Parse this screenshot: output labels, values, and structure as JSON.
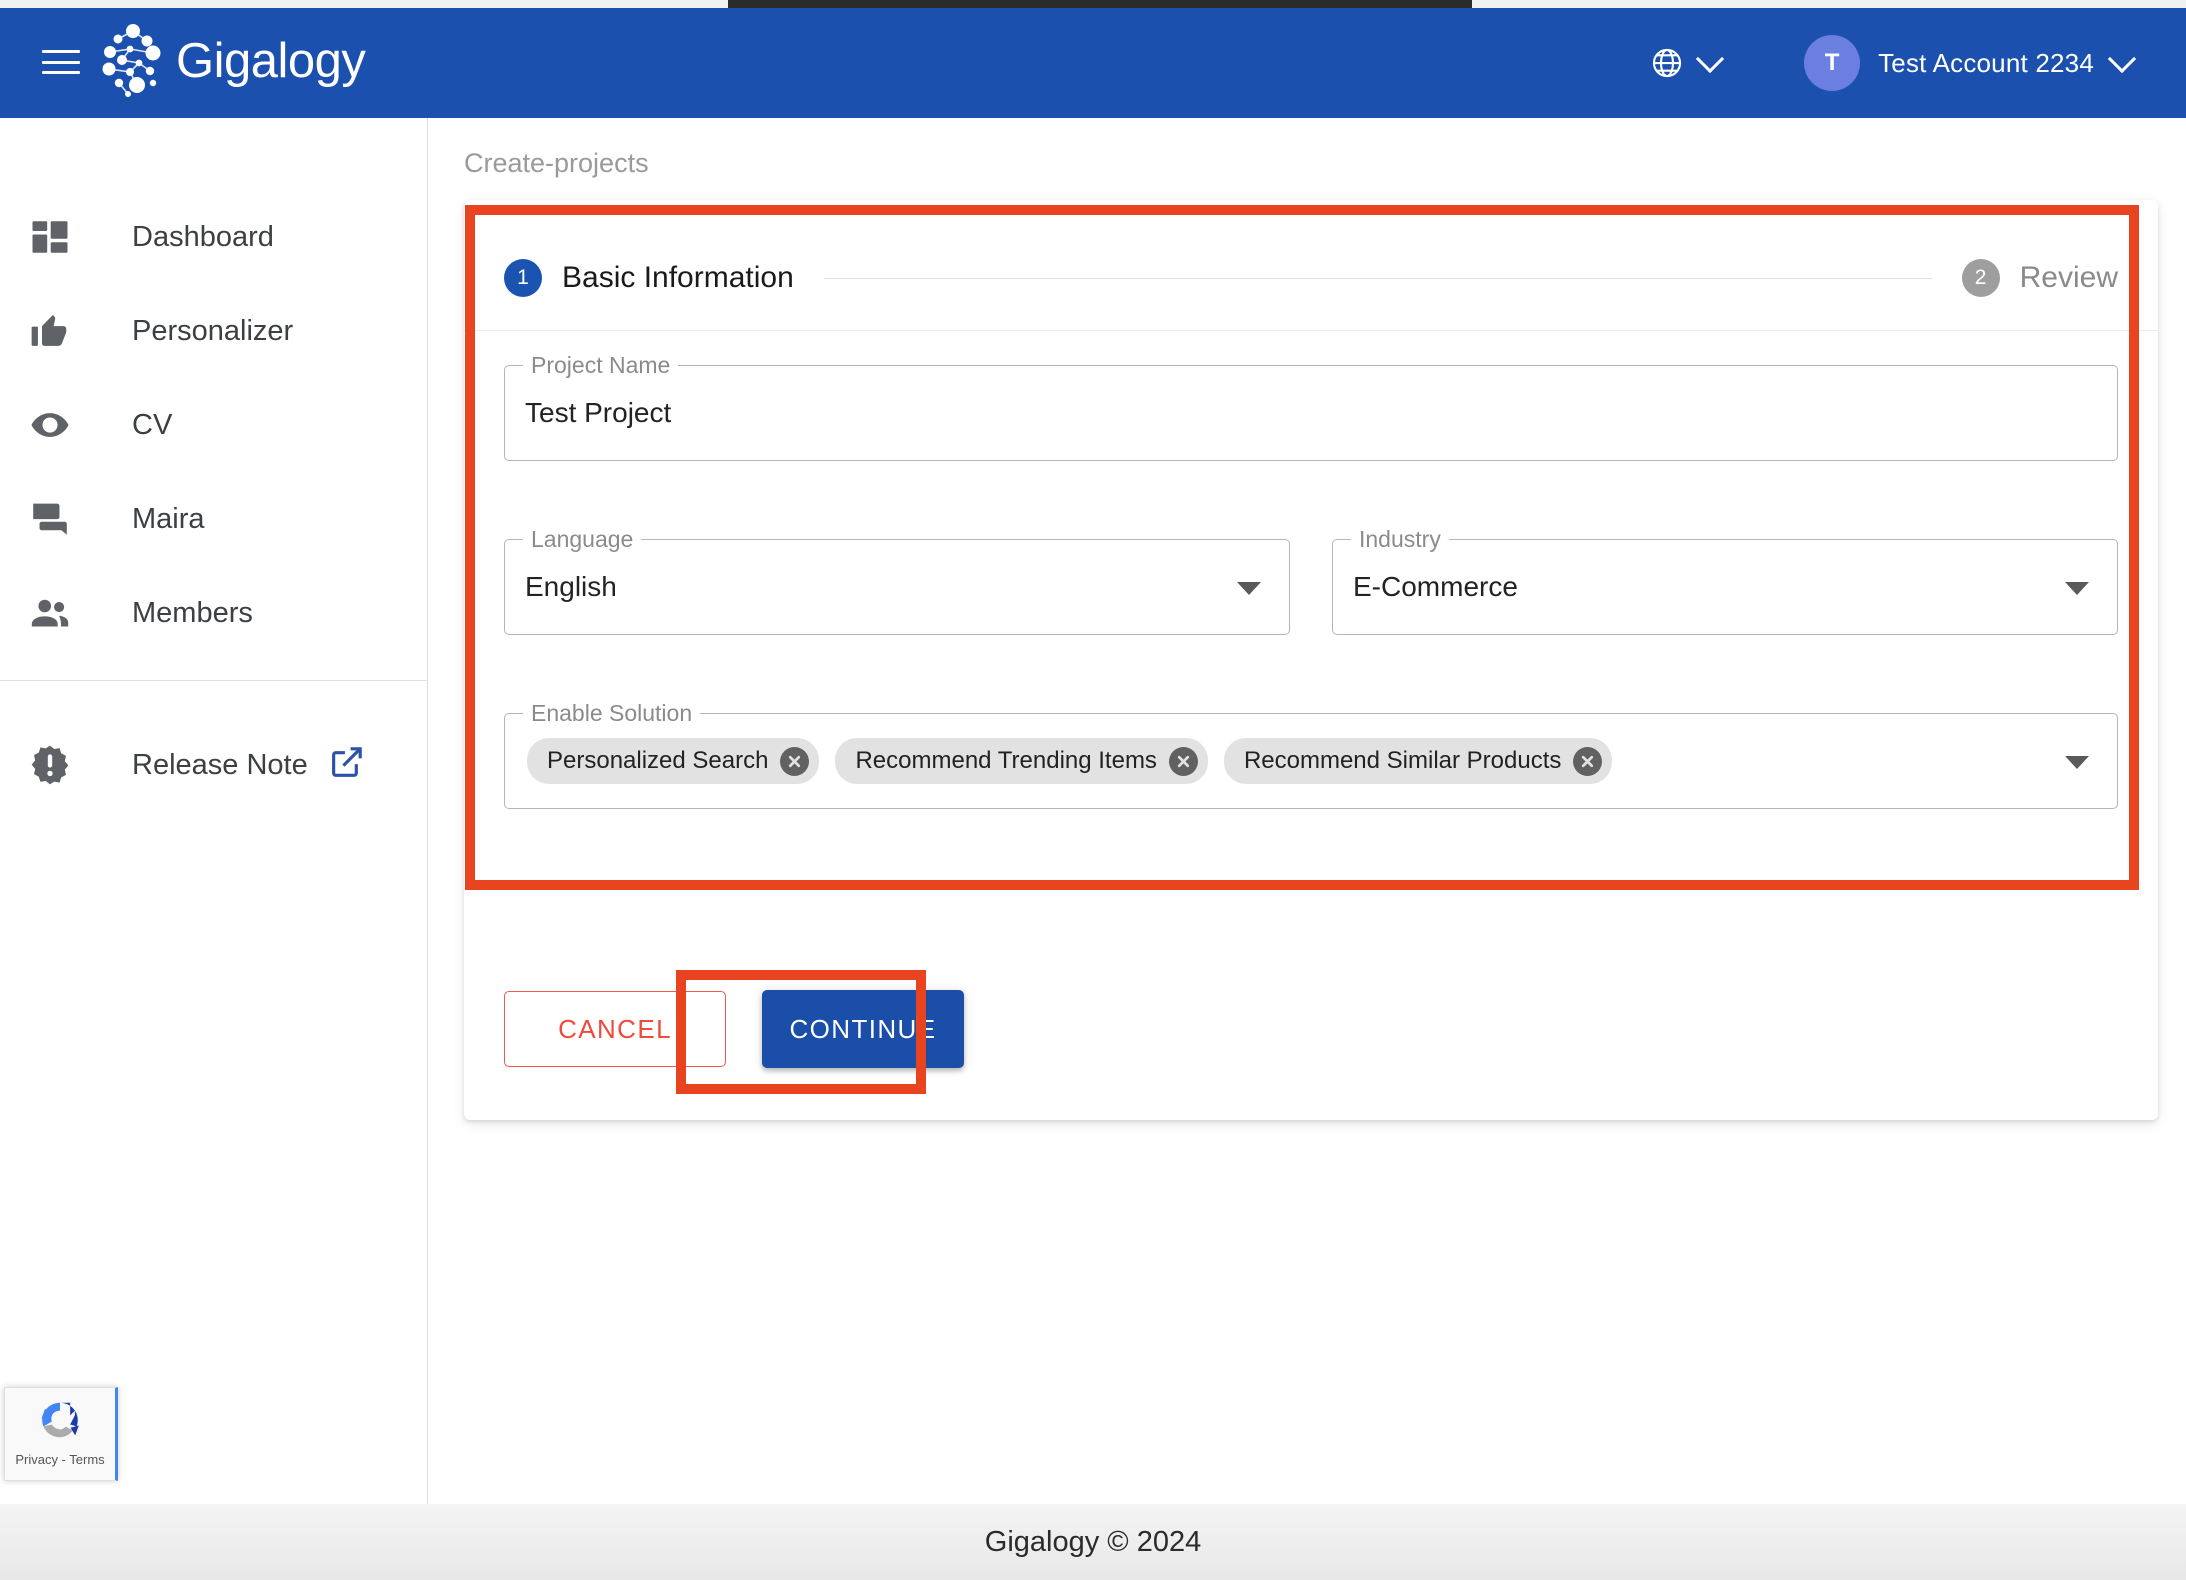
{
  "header": {
    "menu_icon": "hamburger-menu-icon",
    "brand": "Gigalogy",
    "brand_logo_icon": "gigalogy-network-logo-icon",
    "language_icon": "globe-icon",
    "language_caret_icon": "chevron-down-icon",
    "account_initial": "T",
    "account_name": "Test Account 2234",
    "account_caret_icon": "chevron-down-icon",
    "bg_color": "#1b50ae",
    "avatar_color": "#6a7fe0"
  },
  "sidebar": {
    "items": [
      {
        "label": "Dashboard",
        "icon": "dashboard-grid-icon"
      },
      {
        "label": "Personalizer",
        "icon": "thumbs-up-icon"
      },
      {
        "label": "CV",
        "icon": "eye-icon"
      },
      {
        "label": "Maira",
        "icon": "chat-bubbles-icon"
      },
      {
        "label": "Members",
        "icon": "people-group-icon"
      }
    ],
    "release_note": {
      "label": "Release Note",
      "icon": "warning-badge-icon",
      "external_icon": "external-link-icon"
    }
  },
  "main": {
    "breadcrumb": "Create-projects",
    "stepper": {
      "steps": [
        {
          "number": "1",
          "label": "Basic Information",
          "state": "active"
        },
        {
          "number": "2",
          "label": "Review",
          "state": "inactive"
        }
      ],
      "active_color": "#1a53b0",
      "inactive_color": "#9e9e9e"
    },
    "form": {
      "project_name": {
        "label": "Project Name",
        "value": "Test Project"
      },
      "language": {
        "label": "Language",
        "value": "English",
        "caret_icon": "dropdown-triangle-icon"
      },
      "industry": {
        "label": "Industry",
        "value": "E-Commerce",
        "caret_icon": "dropdown-triangle-icon"
      },
      "enable_solution": {
        "label": "Enable Solution",
        "caret_icon": "dropdown-triangle-icon",
        "chips": [
          {
            "label": "Personalized Search",
            "delete_icon": "chip-delete-icon"
          },
          {
            "label": "Recommend Trending Items",
            "delete_icon": "chip-delete-icon"
          },
          {
            "label": "Recommend Similar Products",
            "delete_icon": "chip-delete-icon"
          }
        ]
      }
    },
    "actions": {
      "cancel_label": "CANCEL",
      "continue_label": "CONTINUE",
      "cancel_color": "#f04a3a",
      "continue_color": "#1a4ea8"
    }
  },
  "annotations": {
    "color": "#e8441f",
    "boxes": [
      "basic-information-form",
      "continue-button"
    ]
  },
  "recaptcha": {
    "text": "Privacy - Terms",
    "logo_icon": "recaptcha-logo-icon"
  },
  "footer": {
    "text": "Gigalogy © 2024"
  }
}
